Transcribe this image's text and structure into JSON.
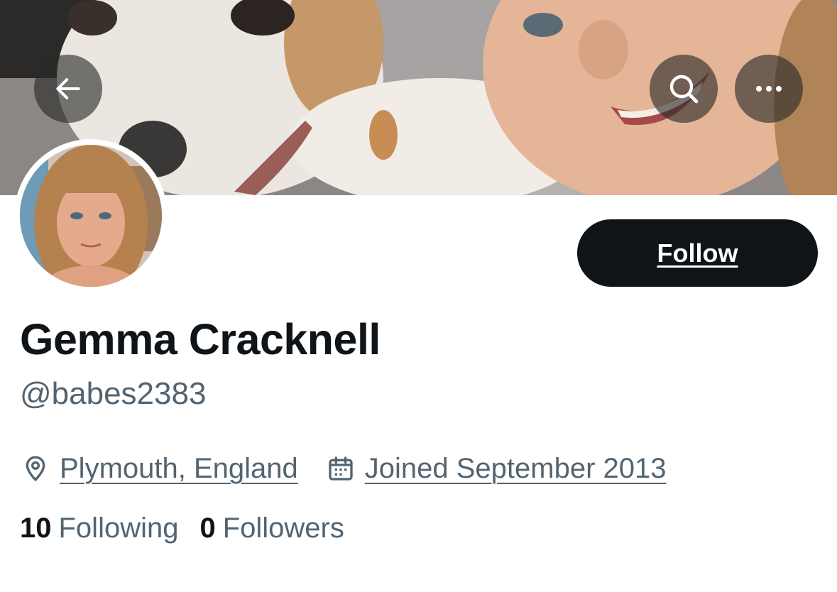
{
  "header": {
    "back_icon": "arrow-left-icon",
    "search_icon": "search-icon",
    "more_icon": "more-horizontal-icon"
  },
  "profile": {
    "name": "Gemma Cracknell",
    "handle": "@babes2383",
    "follow_label": "Follow",
    "location": "Plymouth, England",
    "joined": "Joined September 2013",
    "following_count": "10",
    "following_label": "Following",
    "followers_count": "0",
    "followers_label": "Followers"
  },
  "colors": {
    "primary_text": "#0f1419",
    "secondary_text": "#536471",
    "follow_button_bg": "#0f1419"
  }
}
